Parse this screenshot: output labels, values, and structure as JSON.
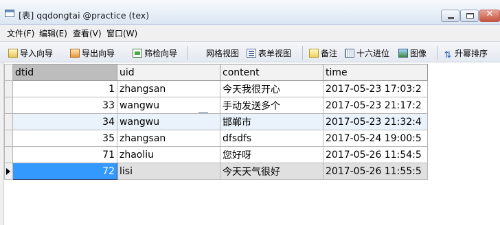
{
  "window": {
    "title": "[表] qqdongtai @practice (tex)",
    "close_glyph": "✕"
  },
  "menu": [
    "文件(F)",
    "编辑(E)",
    "查看(V)",
    "窗口(W)"
  ],
  "toolbar": {
    "import_wizard": "导入向导",
    "export_wizard": "导出向导",
    "filter_wizard": "筛检向导",
    "grid_view": "网格视图",
    "form_view": "表单视图",
    "memo": "备注",
    "hex": "十六进位",
    "image": "图像",
    "sort_asc": "升幂排序"
  },
  "table": {
    "columns": [
      "dtid",
      "uid",
      "content",
      "time"
    ],
    "rows": [
      [
        "1",
        "zhangsan",
        "今天我很开心",
        "2017-05-23 17:03:2"
      ],
      [
        "33",
        "wangwu",
        "手动发送多个",
        "2017-05-23 21:17:2"
      ],
      [
        "34",
        "wangwu",
        "邯郸市",
        "2017-05-23 21:32:4"
      ],
      [
        "35",
        "zhangsan",
        "dfsdfs",
        "2017-05-24 19:00:5"
      ],
      [
        "71",
        "zhaoliu",
        "您好呀",
        "2017-05-26 11:54:5"
      ],
      [
        "72",
        "lisi",
        "今天天气很好",
        "2017-05-26 11:55:5"
      ]
    ],
    "selected_row_index": 5
  }
}
